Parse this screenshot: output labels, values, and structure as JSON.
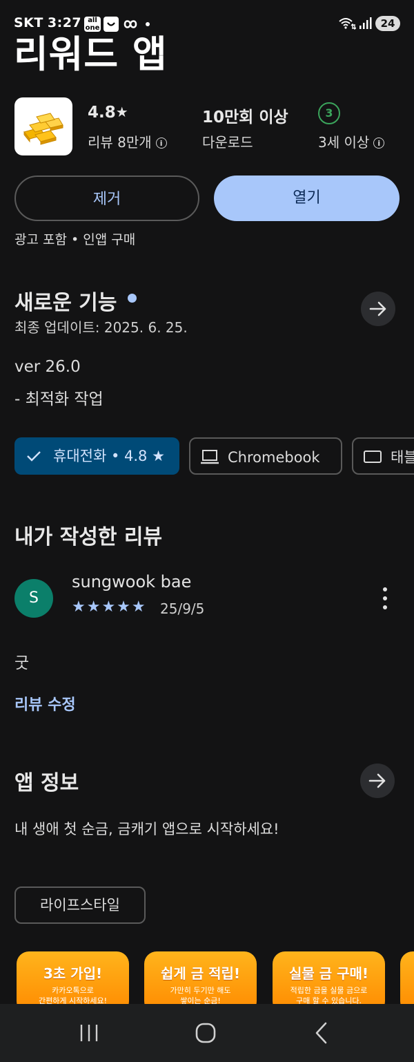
{
  "status_bar": {
    "carrier": "SKT",
    "time": "3:27",
    "battery": "24",
    "icons": [
      "all-one-icon",
      "smile-app-icon",
      "infinity-icon",
      "dot-icon",
      "wifi-icon",
      "signal-icon",
      "battery-icon"
    ]
  },
  "app": {
    "title": "리워드 앱",
    "icon": "gold-bars-icon"
  },
  "stats": {
    "rating": "4.8",
    "rating_star": "★",
    "reviews": "리뷰 8만개",
    "downloads": "10만회 이상",
    "downloads_label": "다운로드",
    "age_badge": "3",
    "age_label": "3세 이상"
  },
  "buttons": {
    "uninstall": "제거",
    "open": "열기"
  },
  "ads_note": "광고 포함 • 인앱 구매",
  "whats_new": {
    "title": "새로운 기능",
    "updated": "최종 업데이트: 2025. 6. 25.",
    "version": "ver 26.0",
    "notes": "- 최적화 작업"
  },
  "device_chips": [
    {
      "label": "휴대전화 • 4.8 ★",
      "selected": true,
      "icon": "check-icon"
    },
    {
      "label": "Chromebook",
      "selected": false,
      "icon": "laptop-icon"
    },
    {
      "label": "태블",
      "selected": false,
      "icon": "tablet-icon"
    }
  ],
  "my_review": {
    "title": "내가 작성한 리뷰",
    "avatar_letter": "S",
    "reviewer": "sungwook bae",
    "stars": "★★★★★",
    "date": "25/9/5",
    "text": "굿",
    "edit_link": "리뷰 수정"
  },
  "about": {
    "title": "앱 정보",
    "description": "내 생애 첫 순금, 금캐기 앱으로 시작하세요!",
    "category": "라이프스타일"
  },
  "screenshots": [
    {
      "headline": "3초 가입!",
      "sub1": "카카오톡으로",
      "sub2": "간편하게 시작하세요!"
    },
    {
      "headline": "쉽게 금 적립!",
      "sub1": "가만히 두기만 해도",
      "sub2": "쌓이는 순금!"
    },
    {
      "headline": "실물 금 구매!",
      "sub1": "적립한 금을 실물 금으로",
      "sub2": "구매 할 수 있습니다."
    }
  ],
  "colors": {
    "background": "#131314",
    "accent": "#a8c7fa",
    "selected_chip": "#004a77",
    "age_green": "#3ba55c",
    "avatar": "#0b7f6a"
  }
}
